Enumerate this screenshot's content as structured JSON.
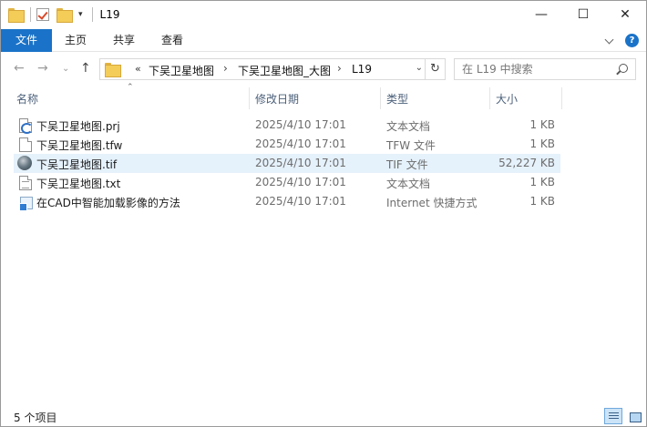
{
  "window": {
    "title": "L19",
    "controls": {
      "minimize": "—",
      "maximize": "☐",
      "close": "✕"
    }
  },
  "ribbon": {
    "tabs": [
      {
        "label": "文件",
        "active": true
      },
      {
        "label": "主页"
      },
      {
        "label": "共享"
      },
      {
        "label": "查看"
      }
    ],
    "accent_color": "#1a73c8",
    "help_label": "?"
  },
  "navigation": {
    "back_glyph": "←",
    "forward_glyph": "→",
    "recent_glyph": "⌄",
    "up_glyph": "↑",
    "overflow": "«",
    "breadcrumbs": [
      "下吴卫星地图",
      "下吴卫星地图_大图",
      "L19"
    ],
    "crumb_separator": "›",
    "dropdown_glyph": "⌄",
    "refresh_glyph": "↻"
  },
  "search": {
    "placeholder": "在 L19 中搜索",
    "value": ""
  },
  "columns": {
    "name": "名称",
    "date": "修改日期",
    "type": "类型",
    "size": "大小",
    "sort_indicator": "⌃"
  },
  "files": [
    {
      "name": "下吴卫星地图.prj",
      "date": "2025/4/10 17:01",
      "type": "文本文档",
      "size": "1 KB",
      "icon": "prj-file-icon",
      "selected": false
    },
    {
      "name": "下吴卫星地图.tfw",
      "date": "2025/4/10 17:01",
      "type": "TFW 文件",
      "size": "1 KB",
      "icon": "blank-file-icon",
      "selected": false
    },
    {
      "name": "下吴卫星地图.tif",
      "date": "2025/4/10 17:01",
      "type": "TIF 文件",
      "size": "52,227 KB",
      "icon": "globe-icon",
      "selected": true
    },
    {
      "name": "下吴卫星地图.txt",
      "date": "2025/4/10 17:01",
      "type": "文本文档",
      "size": "1 KB",
      "icon": "text-file-icon",
      "selected": false
    },
    {
      "name": "在CAD中智能加载影像的方法",
      "date": "2025/4/10 17:01",
      "type": "Internet 快捷方式",
      "size": "1 KB",
      "icon": "internet-shortcut-icon",
      "selected": false
    }
  ],
  "status": {
    "item_count": "5 个项目"
  }
}
